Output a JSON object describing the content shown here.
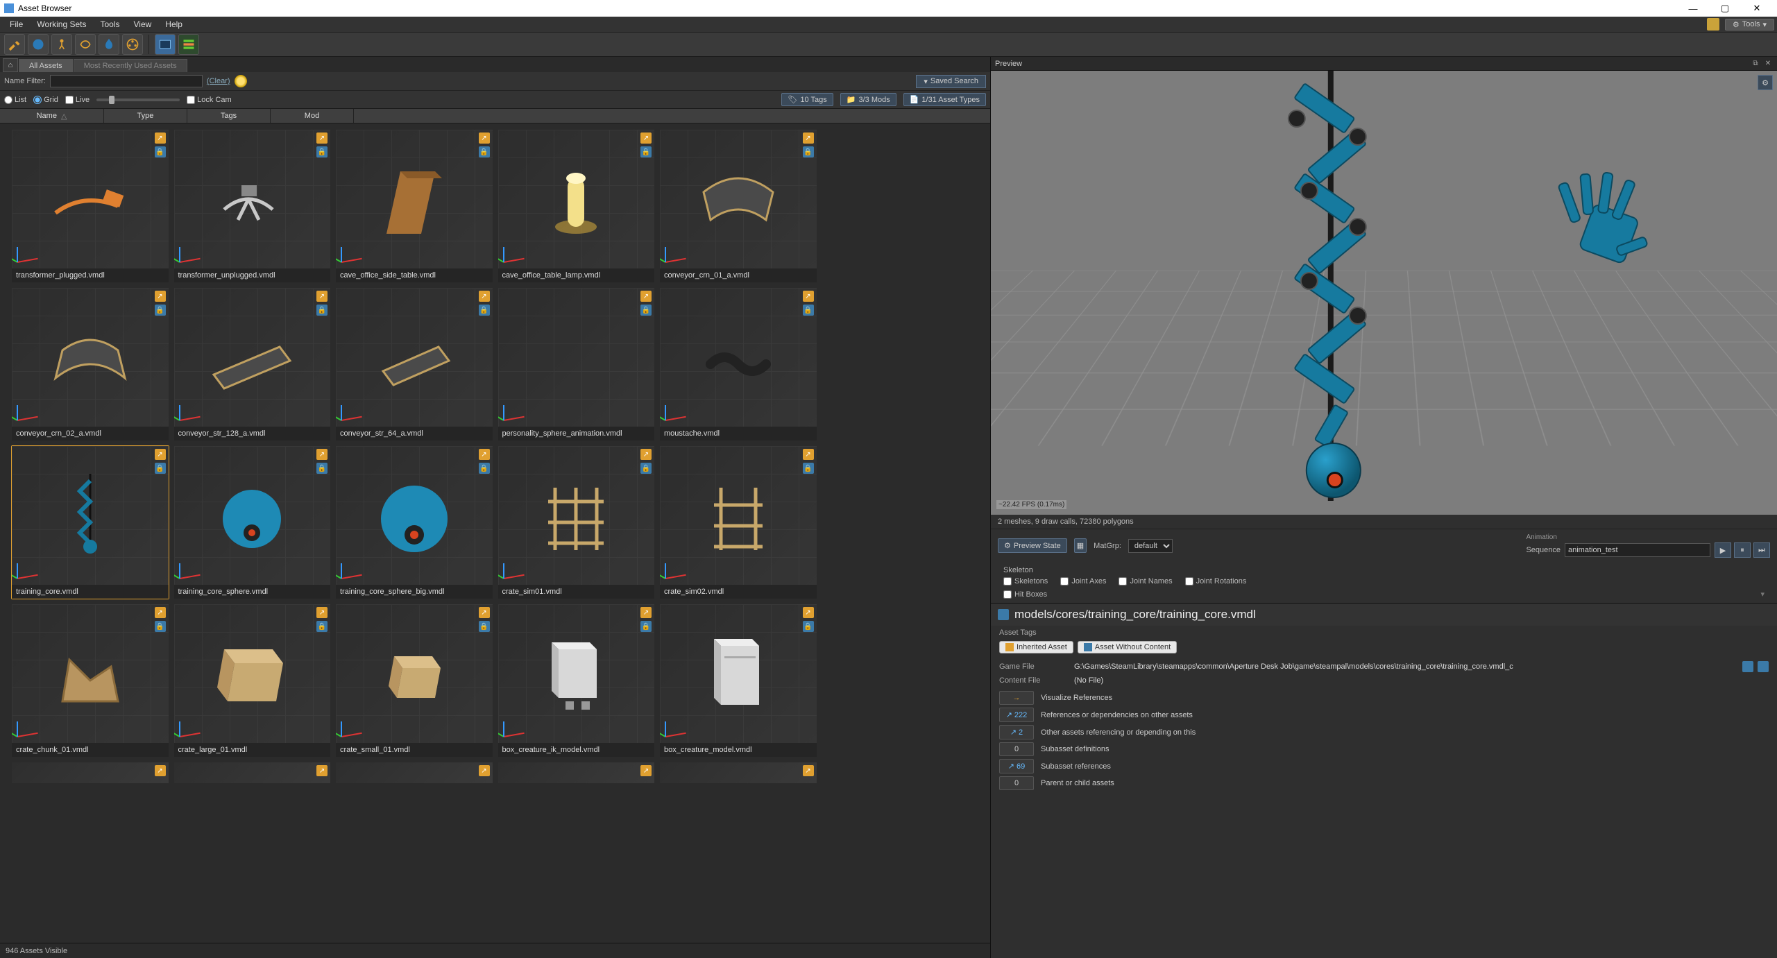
{
  "window": {
    "title": "Asset Browser"
  },
  "menu": {
    "items": [
      "File",
      "Working Sets",
      "Tools",
      "View",
      "Help"
    ],
    "tools_dd": "Tools"
  },
  "tabs": {
    "all": "All Assets",
    "mru": "Most Recently Used Assets"
  },
  "filter": {
    "label": "Name Filter:",
    "value": "",
    "clear": "(Clear)",
    "saved": "Saved Search"
  },
  "view": {
    "list": "List",
    "grid": "Grid",
    "live": "Live",
    "lockcam": "Lock Cam",
    "tags_btn": "10 Tags",
    "mods_btn": "3/3 Mods",
    "types_btn": "1/31 Asset Types"
  },
  "columns": {
    "name": "Name",
    "type": "Type",
    "tags": "Tags",
    "mod": "Mod"
  },
  "status": {
    "text": "946 Assets Visible"
  },
  "assets": [
    {
      "name": "transformer_plugged.vmdl"
    },
    {
      "name": "transformer_unplugged.vmdl"
    },
    {
      "name": "cave_office_side_table.vmdl"
    },
    {
      "name": "cave_office_table_lamp.vmdl"
    },
    {
      "name": "conveyor_crn_01_a.vmdl"
    },
    {
      "name": "conveyor_crn_02_a.vmdl"
    },
    {
      "name": "conveyor_str_128_a.vmdl"
    },
    {
      "name": "conveyor_str_64_a.vmdl"
    },
    {
      "name": "personality_sphere_animation.vmdl"
    },
    {
      "name": "moustache.vmdl"
    },
    {
      "name": "training_core.vmdl",
      "selected": true
    },
    {
      "name": "training_core_sphere.vmdl"
    },
    {
      "name": "training_core_sphere_big.vmdl"
    },
    {
      "name": "crate_sim01.vmdl"
    },
    {
      "name": "crate_sim02.vmdl"
    },
    {
      "name": "crate_chunk_01.vmdl"
    },
    {
      "name": "crate_large_01.vmdl"
    },
    {
      "name": "crate_small_01.vmdl"
    },
    {
      "name": "box_creature_ik_model.vmdl"
    },
    {
      "name": "box_creature_model.vmdl"
    }
  ],
  "preview": {
    "title": "Preview",
    "stats": "2 meshes, 9 draw calls, 72380 polygons",
    "fps": "~22.42 FPS  (0.17ms)",
    "preview_state_btn": "Preview State",
    "matgrp_label": "MatGrp:",
    "matgrp_value": "default",
    "anim_header": "Animation",
    "seq_label": "Sequence",
    "seq_value": "animation_test",
    "skel_header": "Skeleton",
    "cb_skeletons": "Skeletons",
    "cb_jointaxes": "Joint Axes",
    "cb_jointnames": "Joint Names",
    "cb_jointrot": "Joint Rotations",
    "cb_hitboxes": "Hit Boxes"
  },
  "details": {
    "path": "models/cores/training_core/training_core.vmdl",
    "tags_label": "Asset Tags",
    "chip_inherited": "Inherited Asset",
    "chip_nocontent": "Asset Without Content",
    "gamefile_label": "Game File",
    "gamefile_value": "G:\\Games\\SteamLibrary\\steamapps\\common\\Aperture Desk Job\\game\\steampal\\models\\cores\\training_core\\training_core.vmdl_c",
    "contentfile_label": "Content File",
    "contentfile_value": "(No File)",
    "refs": [
      {
        "count": "",
        "icon": "vis",
        "label": "Visualize References"
      },
      {
        "count": "222",
        "icon": "ext",
        "label": "References or dependencies on other assets"
      },
      {
        "count": "2",
        "icon": "ext",
        "label": "Other assets referencing or depending on this"
      },
      {
        "count": "0",
        "icon": "",
        "label": "Subasset definitions"
      },
      {
        "count": "69",
        "icon": "ext",
        "label": "Subasset references"
      },
      {
        "count": "0",
        "icon": "",
        "label": "Parent or child assets"
      }
    ]
  }
}
